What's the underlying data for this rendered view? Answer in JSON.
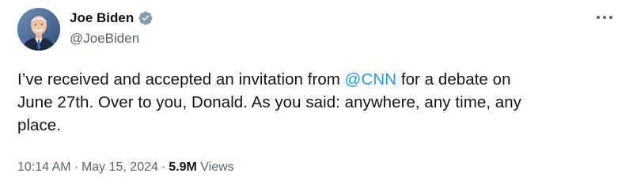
{
  "author": {
    "display_name": "Joe Biden",
    "handle": "@JoeBiden",
    "verified": true,
    "avatar_icon": "profile-photo"
  },
  "more_icon": "ellipsis-icon",
  "tweet": {
    "text_before": "I’ve received and accepted an invitation from ",
    "mention": "@CNN",
    "text_after_line1": " for a debate on",
    "line2": "June 27th. Over to you, Donald. As you said: anywhere, any time, any",
    "line3": "place."
  },
  "meta": {
    "time": "10:14 AM",
    "separator": "·",
    "date": "May 15, 2024",
    "views_count": "5.9M",
    "views_label": "Views"
  },
  "colors": {
    "link": "#1d9bf0",
    "verified_badge": "#829aab",
    "secondary_text": "#536471",
    "primary_text": "#0f1419"
  }
}
